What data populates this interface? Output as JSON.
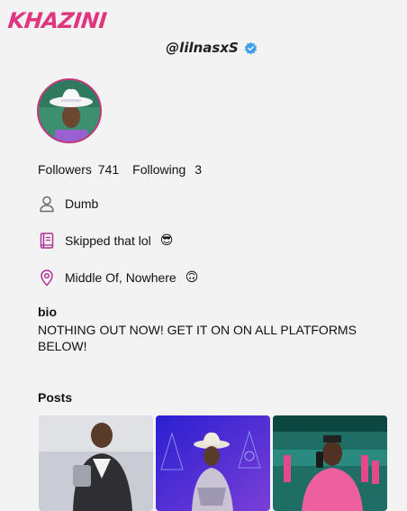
{
  "brand": {
    "logo_text": "KHAZINI",
    "accent_color": "#e0357f"
  },
  "profile": {
    "handle": "@lilnasxS",
    "verified": true,
    "verified_icon": "verified-badge-icon",
    "avatar_icon": "avatar-photo"
  },
  "stats": {
    "followers_label": "Followers",
    "followers_count": "741",
    "following_label": "Following",
    "following_count": "3"
  },
  "details": {
    "name": {
      "icon": "user-icon",
      "text": "Dumb"
    },
    "workplace": {
      "icon": "book-icon",
      "text": "Skipped that lol",
      "emoji": "😎"
    },
    "location": {
      "icon": "location-pin-icon",
      "text": "Middle Of, Nowhere",
      "emoji": "🙃"
    }
  },
  "bio": {
    "title": "bio",
    "text": "NOTHING OUT NOW! GET IT ON ON ALL PLATFORMS BELOW!"
  },
  "posts": {
    "title": "Posts",
    "items": [
      {
        "name": "post-1",
        "colors": [
          "#c9ccd2",
          "#3b3b3b"
        ]
      },
      {
        "name": "post-2",
        "colors": [
          "#3a2fd6",
          "#6b3fd9"
        ]
      },
      {
        "name": "post-3",
        "colors": [
          "#1f7d74",
          "#e24a8a"
        ]
      }
    ]
  }
}
